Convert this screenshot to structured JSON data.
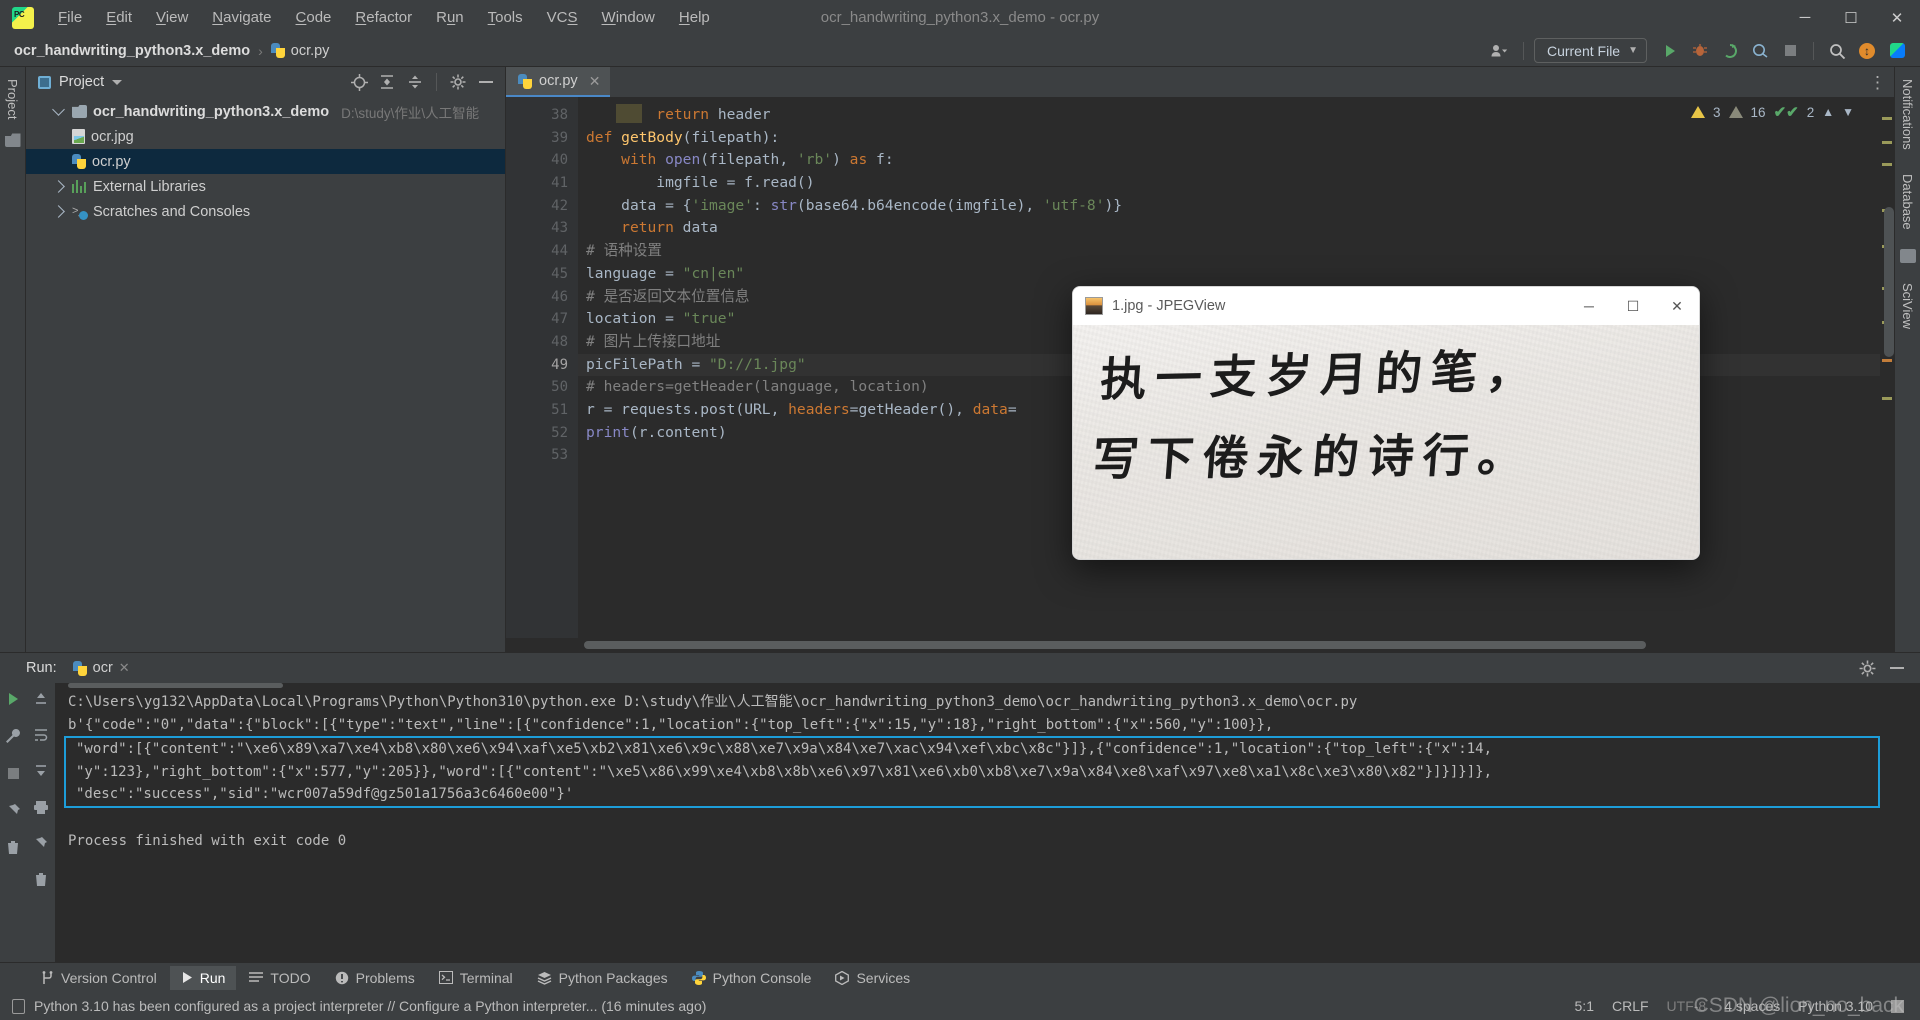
{
  "window": {
    "title": "ocr_handwriting_python3.x_demo - ocr.py",
    "minimize": "─",
    "maximize": "☐",
    "close": "✕"
  },
  "menu": {
    "items": [
      "File",
      "Edit",
      "View",
      "Navigate",
      "Code",
      "Refactor",
      "Run",
      "Tools",
      "VCS",
      "Window",
      "Help"
    ]
  },
  "breadcrumb": {
    "project": "ocr_handwriting_python3.x_demo",
    "separator": "›",
    "file": "ocr.py"
  },
  "navbar_right": {
    "run_config": "Current File",
    "search_icon": "⌕",
    "user_icon": "user-group-icon",
    "run_icon": "run-icon",
    "debug_icon": "debug-icon",
    "coverage_icon": "coverage-icon",
    "profile_icon": "profile-icon",
    "stop_icon": "stop-icon",
    "updates_icon": "updates-icon",
    "ide_icon": "ide-icon"
  },
  "left_strip": {
    "label": "Project"
  },
  "right_strip": {
    "labels": [
      "Notifications",
      "Database",
      "SciView"
    ]
  },
  "project_panel": {
    "title": "Project",
    "tree": [
      {
        "label": "ocr_handwriting_python3.x_demo",
        "path": "D:\\study\\作业\\人工智能",
        "icon": "folder-icon",
        "level": 0,
        "expanded": true,
        "bold": true,
        "selected": false
      },
      {
        "label": "ocr.jpg",
        "path": "",
        "icon": "jpg-file-icon",
        "level": 1,
        "expanded": false,
        "bold": false,
        "selected": false
      },
      {
        "label": "ocr.py",
        "path": "",
        "icon": "python-file-icon",
        "level": 1,
        "expanded": false,
        "bold": false,
        "selected": true
      },
      {
        "label": "External Libraries",
        "path": "",
        "icon": "library-icon",
        "level": 0,
        "expanded": false,
        "bold": false,
        "selected": false
      },
      {
        "label": "Scratches and Consoles",
        "path": "",
        "icon": "scratches-icon",
        "level": 0,
        "expanded": false,
        "bold": false,
        "selected": false
      }
    ]
  },
  "editor": {
    "tab": {
      "label": "ocr.py",
      "close": "✕"
    },
    "inspections": {
      "warnings": "3",
      "weak_warnings": "16",
      "checks": "2"
    },
    "first_line_number": 38,
    "lines": [
      {
        "n": 38,
        "indent": 2,
        "current": false,
        "fold": "end",
        "tokens": [
          [
            "kw",
            "return "
          ],
          [
            "id",
            "header"
          ]
        ]
      },
      {
        "n": 39,
        "indent": 0,
        "current": false,
        "fold": "start",
        "tokens": [
          [
            "kw",
            "def "
          ],
          [
            "fn",
            "getBody"
          ],
          [
            "par",
            "("
          ],
          [
            "id",
            "filepath"
          ],
          [
            "par",
            "):"
          ]
        ]
      },
      {
        "n": 40,
        "indent": 1,
        "current": false,
        "fold": "",
        "tokens": [
          [
            "kw",
            "with "
          ],
          [
            "blt",
            "open"
          ],
          [
            "par",
            "("
          ],
          [
            "id",
            "filepath"
          ],
          [
            "par",
            ", "
          ],
          [
            "str",
            "'rb'"
          ],
          [
            "par",
            ") "
          ],
          [
            "kw",
            "as "
          ],
          [
            "id",
            "f"
          ],
          [
            "par",
            ":"
          ]
        ]
      },
      {
        "n": 41,
        "indent": 2,
        "current": false,
        "fold": "",
        "tokens": [
          [
            "id",
            "imgfile"
          ],
          [
            "par",
            " = "
          ],
          [
            "id",
            "f"
          ],
          [
            "par",
            "."
          ],
          [
            "id",
            "read"
          ],
          [
            "par",
            "()"
          ]
        ]
      },
      {
        "n": 42,
        "indent": 1,
        "current": false,
        "fold": "",
        "tokens": [
          [
            "id",
            "data"
          ],
          [
            "par",
            " = {"
          ],
          [
            "str",
            "'image'"
          ],
          [
            "par",
            ": "
          ],
          [
            "blt",
            "str"
          ],
          [
            "par",
            "("
          ],
          [
            "id",
            "base64"
          ],
          [
            "par",
            "."
          ],
          [
            "id",
            "b64encode"
          ],
          [
            "par",
            "("
          ],
          [
            "id",
            "imgfile"
          ],
          [
            "par",
            "), "
          ],
          [
            "str",
            "'utf-8'"
          ],
          [
            "par",
            ")}"
          ]
        ]
      },
      {
        "n": 43,
        "indent": 1,
        "current": false,
        "fold": "end",
        "tokens": [
          [
            "kw",
            "return "
          ],
          [
            "id",
            "data"
          ]
        ]
      },
      {
        "n": 44,
        "indent": 0,
        "current": false,
        "fold": "",
        "tokens": [
          [
            "cm",
            "# 语种设置"
          ]
        ]
      },
      {
        "n": 45,
        "indent": 0,
        "current": false,
        "fold": "",
        "tokens": [
          [
            "id",
            "language"
          ],
          [
            "par",
            " = "
          ],
          [
            "str",
            "\"cn|en\""
          ]
        ]
      },
      {
        "n": 46,
        "indent": 0,
        "current": false,
        "fold": "",
        "tokens": [
          [
            "cm",
            "# 是否返回文本位置信息"
          ]
        ]
      },
      {
        "n": 47,
        "indent": 0,
        "current": false,
        "fold": "",
        "tokens": [
          [
            "id",
            "location"
          ],
          [
            "par",
            " = "
          ],
          [
            "str",
            "\"true\""
          ]
        ]
      },
      {
        "n": 48,
        "indent": 0,
        "current": false,
        "fold": "",
        "tokens": [
          [
            "cm",
            "# 图片上传接口地址"
          ]
        ]
      },
      {
        "n": 49,
        "indent": 0,
        "current": true,
        "fold": "",
        "tokens": [
          [
            "id",
            "picFilePath"
          ],
          [
            "par",
            " = "
          ],
          [
            "str",
            "\"D://1.jpg\""
          ]
        ]
      },
      {
        "n": 50,
        "indent": 0,
        "current": false,
        "fold": "",
        "tokens": [
          [
            "cm",
            "# headers=getHeader(language, location)"
          ]
        ]
      },
      {
        "n": 51,
        "indent": 0,
        "current": false,
        "fold": "",
        "tokens": [
          [
            "id",
            "r"
          ],
          [
            "par",
            " = "
          ],
          [
            "id",
            "requests"
          ],
          [
            "par",
            "."
          ],
          [
            "id",
            "post"
          ],
          [
            "par",
            "("
          ],
          [
            "id",
            "URL"
          ],
          [
            "par",
            ", "
          ],
          [
            "kw",
            "headers"
          ],
          [
            "par",
            "="
          ],
          [
            "id",
            "getHeader"
          ],
          [
            "par",
            "(), "
          ],
          [
            "kw",
            "data"
          ],
          [
            "par",
            "="
          ]
        ]
      },
      {
        "n": 52,
        "indent": 0,
        "current": false,
        "fold": "",
        "tokens": [
          [
            "blt",
            "print"
          ],
          [
            "par",
            "("
          ],
          [
            "id",
            "r"
          ],
          [
            "par",
            "."
          ],
          [
            "id",
            "content"
          ],
          [
            "par",
            ")"
          ]
        ]
      },
      {
        "n": 53,
        "indent": 0,
        "current": false,
        "fold": "",
        "tokens": []
      }
    ]
  },
  "run_panel": {
    "label": "Run:",
    "tab": "ocr",
    "tab_close": "✕",
    "console_lines": [
      {
        "text": "C:\\Users\\yg132\\AppData\\Local\\Programs\\Python\\Python310\\python.exe D:\\study\\作业\\人工智能\\ocr_handwriting_python3_demo\\ocr_handwriting_python3.x_demo\\ocr.py",
        "highlighted": false
      },
      {
        "text": "b'{\"code\":\"0\",\"data\":{\"block\":[{\"type\":\"text\",\"line\":[{\"confidence\":1,\"location\":{\"top_left\":{\"x\":15,\"y\":18},\"right_bottom\":{\"x\":560,\"y\":100}},",
        "highlighted": false
      },
      {
        "text": "\"word\":[{\"content\":\"\\xe6\\x89\\xa7\\xe4\\xb8\\x80\\xe6\\x94\\xaf\\xe5\\xb2\\x81\\xe6\\x9c\\x88\\xe7\\x9a\\x84\\xe7\\xac\\x94\\xef\\xbc\\x8c\"}]},{\"confidence\":1,\"location\":{\"top_left\":{\"x\":14,",
        "highlighted": true
      },
      {
        "text": "\"y\":123},\"right_bottom\":{\"x\":577,\"y\":205}},\"word\":[{\"content\":\"\\xe5\\x86\\x99\\xe4\\xb8\\x8b\\xe6\\x97\\x81\\xe6\\xb0\\xb8\\xe7\\x9a\\x84\\xe8\\xaf\\x97\\xe8\\xa1\\x8c\\xe3\\x80\\x82\"}]}]}]},",
        "highlighted": true
      },
      {
        "text": "\"desc\":\"success\",\"sid\":\"wcr007a59df@gz501a1756a3c6460e00\"}'",
        "highlighted": true
      },
      {
        "text": "",
        "highlighted": false
      },
      {
        "text": "Process finished with exit code 0",
        "highlighted": false
      }
    ]
  },
  "bottom_toolwindows": [
    {
      "label": "Version Control",
      "icon": "branch-icon",
      "active": false
    },
    {
      "label": "Run",
      "icon": "play-icon",
      "active": true
    },
    {
      "label": "TODO",
      "icon": "list-icon",
      "active": false
    },
    {
      "label": "Problems",
      "icon": "warning-circle-icon",
      "active": false
    },
    {
      "label": "Terminal",
      "icon": "terminal-icon",
      "active": false
    },
    {
      "label": "Python Packages",
      "icon": "packages-icon",
      "active": false
    },
    {
      "label": "Python Console",
      "icon": "python-icon",
      "active": false
    },
    {
      "label": "Services",
      "icon": "services-icon",
      "active": false
    }
  ],
  "statusbar": {
    "message": "Python 3.10 has been configured as a project interpreter // Configure a Python interpreter... (16 minutes ago)",
    "caret": "5:1",
    "line_separator": "CRLF",
    "encoding": "UTF-8",
    "indent": "4 spaces",
    "interpreter": "Python 3.10"
  },
  "jpegview": {
    "title": "1.jpg - JPEGView",
    "minimize": "─",
    "maximize": "☐",
    "close": "✕",
    "image_line1": "执一支岁月的笔，",
    "image_line2": "写下倦永的诗行。"
  },
  "watermark": "CSDN @lion_no_back",
  "colors": {
    "accent_blue": "#1d9dd9",
    "selection_blue": "#0d293e",
    "green_run": "#59a869",
    "warning_yellow": "#e8c547",
    "editor_bg": "#2b2b2b",
    "chrome_bg": "#3c3f41"
  }
}
